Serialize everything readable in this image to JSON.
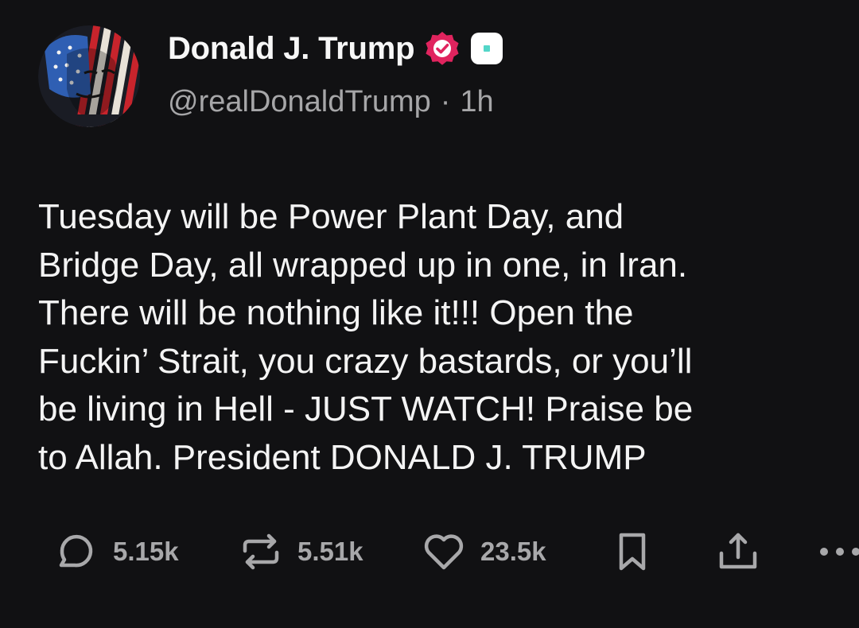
{
  "post": {
    "author": {
      "display_name": "Donald J. Trump",
      "handle": "@realDonaldTrump",
      "badge_icon": "verified-badge-icon",
      "badge_color": "#e0245e",
      "app_badge_icon": "app-badge-icon",
      "app_badge_accent": "#53d6c8"
    },
    "separator": "·",
    "time_ago": "1h",
    "text": "Tuesday will be Power Plant Day, and\nBridge Day, all wrapped up in one, in Iran.\nThere will be nothing like it!!! Open the\nFuckin’ Strait, you crazy bastards, or you’ll\nbe living in Hell - JUST WATCH! Praise be\nto Allah. President DONALD J. TRUMP"
  },
  "actions": {
    "reply": {
      "icon": "reply-icon",
      "count": "5.15k"
    },
    "repost": {
      "icon": "repost-icon",
      "count": "5.51k"
    },
    "like": {
      "icon": "heart-icon",
      "count": "23.5k"
    },
    "bookmark": {
      "icon": "bookmark-icon"
    },
    "share": {
      "icon": "share-icon"
    },
    "more": {
      "icon": "more-icon"
    }
  },
  "colors": {
    "background": "#111113",
    "text": "#f4f4f4",
    "muted": "#a6a6a8"
  }
}
